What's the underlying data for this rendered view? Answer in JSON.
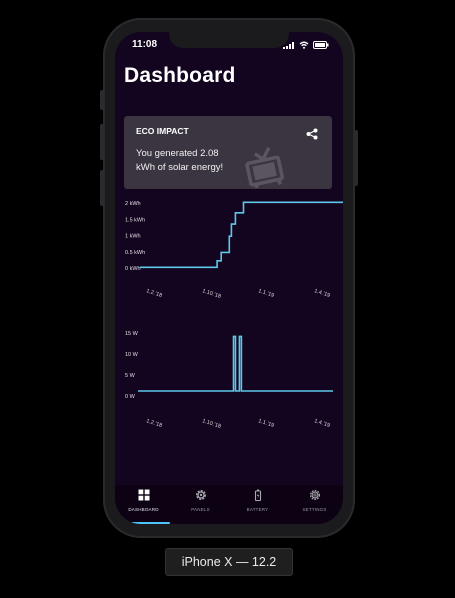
{
  "status_bar": {
    "time": "11:08"
  },
  "page": {
    "title": "Dashboard"
  },
  "eco_card": {
    "heading": "ECO IMPACT",
    "line1": "You generated 2.08",
    "line2": "kWh of solar energy!",
    "share_icon": "share-icon",
    "illustration": "tv-icon"
  },
  "chart_data": [
    {
      "type": "line",
      "ylim": [
        0,
        2
      ],
      "y_ticks": [
        "0 kWh",
        "0.5 kWh",
        "1 kWh",
        "1.5 kWh",
        "2 kWh"
      ],
      "x_ticks": [
        "1.2.'18",
        "1.10.'18",
        "1.1.'19",
        "1.4.'19"
      ],
      "series": [
        {
          "color": "#5ec8e8",
          "points": [
            [
              0.0,
              0.02
            ],
            [
              0.38,
              0.02
            ],
            [
              0.38,
              0.22
            ],
            [
              0.4,
              0.22
            ],
            [
              0.4,
              0.48
            ],
            [
              0.44,
              0.48
            ],
            [
              0.44,
              0.98
            ],
            [
              0.45,
              0.98
            ],
            [
              0.45,
              1.35
            ],
            [
              0.47,
              1.35
            ],
            [
              0.47,
              1.7
            ],
            [
              0.51,
              1.7
            ],
            [
              0.51,
              2.02
            ],
            [
              1.0,
              2.02
            ]
          ]
        }
      ]
    },
    {
      "type": "line",
      "ylim": [
        0,
        15
      ],
      "y_ticks": [
        "0 W",
        "5 W",
        "10 W",
        "15 W"
      ],
      "x_ticks": [
        "1.2.'18",
        "1.10.'18",
        "1.1.'19",
        "1.4.'19"
      ],
      "series": [
        {
          "color": "#5ec8e8",
          "points": [
            [
              0.0,
              1.2
            ],
            [
              0.49,
              1.2
            ],
            [
              0.49,
              14.2
            ],
            [
              0.5,
              14.2
            ],
            [
              0.5,
              1.2
            ],
            [
              0.52,
              1.2
            ],
            [
              0.52,
              14.2
            ],
            [
              0.53,
              14.2
            ],
            [
              0.53,
              1.2
            ],
            [
              1.0,
              1.2
            ]
          ]
        }
      ]
    }
  ],
  "tabs": [
    {
      "label": "DASHBOARD",
      "icon": "grid-icon",
      "active": true
    },
    {
      "label": "PANELS",
      "icon": "gear-icon",
      "active": false
    },
    {
      "label": "BATTERY",
      "icon": "battery-icon",
      "active": false
    },
    {
      "label": "SETTINGS",
      "icon": "settings-gear-icon",
      "active": false
    }
  ],
  "device_label": "iPhone X — 12.2",
  "colors": {
    "accent": "#5ec8e8",
    "background": "#13041f",
    "card": "#3a3540"
  }
}
